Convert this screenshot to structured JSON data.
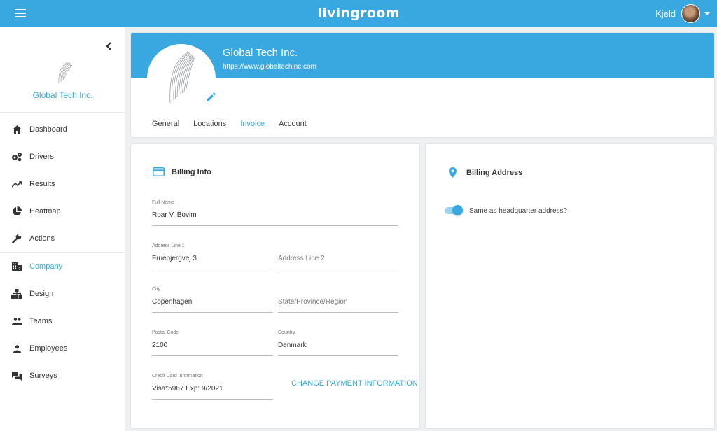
{
  "app": {
    "brand": "livingroom",
    "user_name": "Kjeld"
  },
  "sidebar": {
    "company_name": "Global Tech Inc.",
    "items": [
      {
        "label": "Dashboard",
        "icon": "home-icon"
      },
      {
        "label": "Drivers",
        "icon": "gears-icon"
      },
      {
        "label": "Results",
        "icon": "trending-up-icon"
      },
      {
        "label": "Heatmap",
        "icon": "pie-chart-icon"
      },
      {
        "label": "Actions",
        "icon": "wrench-icon"
      },
      {
        "label": "Company",
        "icon": "building-icon",
        "active": true
      },
      {
        "label": "Design",
        "icon": "sitemap-icon"
      },
      {
        "label": "Teams",
        "icon": "group-icon"
      },
      {
        "label": "Employees",
        "icon": "person-icon"
      },
      {
        "label": "Surveys",
        "icon": "chat-icon"
      }
    ]
  },
  "company": {
    "name": "Global Tech Inc.",
    "url": "https://www.globaltechinc.com",
    "tabs": [
      {
        "label": "General"
      },
      {
        "label": "Locations"
      },
      {
        "label": "Invoice",
        "active": true
      },
      {
        "label": "Account"
      }
    ]
  },
  "billing": {
    "title": "Billing Info",
    "full_name_label": "Full Name",
    "full_name": "Roar V. Bovim",
    "address1_label": "Address Line 1",
    "address1": "Fruebjergvej 3",
    "address2_placeholder": "Address Line 2",
    "city_label": "City",
    "city": "Copenhagen",
    "state_placeholder": "State/Province/Region",
    "postal_label": "Postal Code",
    "postal": "2100",
    "country_label": "Country",
    "country": "Denmark",
    "card_label": "Credit Card Information",
    "card": "Visa*5967 Exp: 9/2021",
    "change_payment": "CHANGE PAYMENT INFORMATION"
  },
  "billing_address": {
    "title": "Billing Address",
    "same_as_hq_label": "Same as headquarter address?",
    "same_as_hq": true
  },
  "colors": {
    "accent": "#3aa8e0"
  }
}
